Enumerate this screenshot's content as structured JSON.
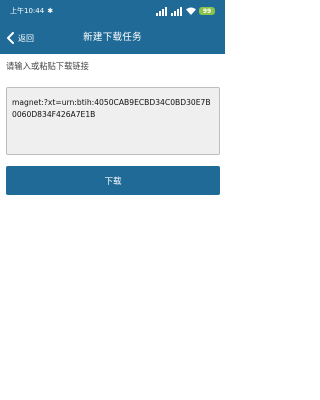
{
  "status_bar": {
    "time": "上午10:44",
    "battery": "99"
  },
  "nav": {
    "back_label": "返回",
    "title": "新建下载任务"
  },
  "prompt": "请输入或粘贴下载链接",
  "input": {
    "value": "magnet:?xt=urn:btih:4050CAB9ECBD34C0BD30E7B0060D834F426A7E1B"
  },
  "download_button": {
    "label": "下载"
  },
  "colors": {
    "primary": "#1f6a97",
    "input_bg": "#efefef",
    "battery": "#8bc34a"
  }
}
